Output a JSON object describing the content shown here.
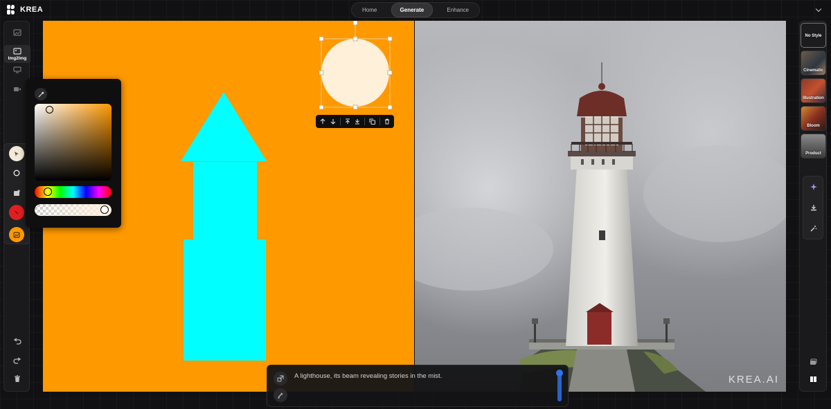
{
  "app": {
    "name": "KREA"
  },
  "nav": {
    "tabs": [
      "Home",
      "Generate",
      "Enhance"
    ],
    "active": "Generate"
  },
  "left_toolbar": {
    "img2img_label": "Img2Img"
  },
  "colors": {
    "canvas_background": "#ff9900",
    "shape_fill": "#00ffff",
    "circle_fill": "#fff0d9",
    "accent_blue": "#2d74e6",
    "active_tool_orange": "#ff9900",
    "red_tool": "#e02020"
  },
  "color_picker": {
    "hue": "#ff9900"
  },
  "styles": {
    "items": [
      "No Style",
      "Cinematic",
      "Illustration",
      "Bloom",
      "Product"
    ],
    "selected": "No Style"
  },
  "prompt": {
    "text": "A lighthouse, its beam revealing stories in the mist."
  },
  "output": {
    "watermark": "KREA.AI"
  }
}
